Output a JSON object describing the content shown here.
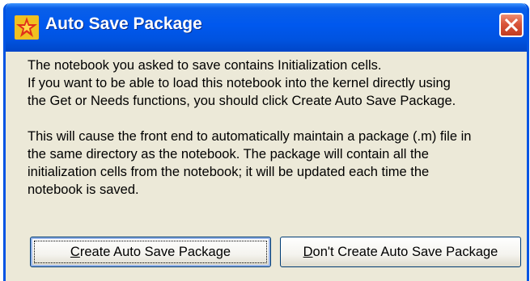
{
  "dialog": {
    "title": "Auto Save Package",
    "app_icon": "mathematica-star-icon",
    "close_icon": "close-icon",
    "paragraph1": [
      "The notebook you asked to save contains Initialization cells.",
      "If you want to be able to load this notebook into the kernel directly using",
      "the Get or Needs functions, you should click Create Auto Save Package."
    ],
    "paragraph2": [
      "This will cause the front end to automatically maintain a package (.m) file in",
      "the same directory as the notebook. The package will contain all the",
      "initialization cells from the notebook; it will be updated each time the",
      "notebook is saved."
    ],
    "buttons": {
      "create": {
        "mnemonic": "C",
        "rest": "reate Auto Save Package"
      },
      "dont": {
        "mnemonic": "D",
        "rest": "on't Create Auto Save Package"
      }
    }
  },
  "colors": {
    "titlebar": "#0058ee",
    "window_bg": "#ece9d8",
    "close_button": "#d9553a"
  }
}
